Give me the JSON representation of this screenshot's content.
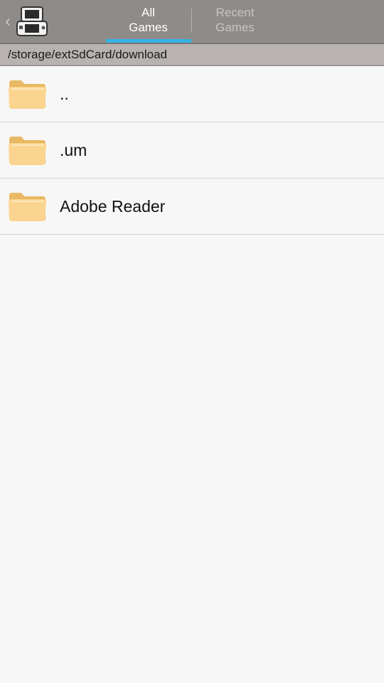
{
  "action_bar": {
    "up_icon": "chevron-left-icon",
    "app_icon": "nintendo-ds-icon",
    "tabs": [
      {
        "label": "All\nGames",
        "selected": true
      },
      {
        "label": "Recent\nGames",
        "selected": false
      }
    ],
    "accent_color": "#33b5e5"
  },
  "path_bar": {
    "path": "/storage/extSdCard/download"
  },
  "files": [
    {
      "name": "..",
      "icon": "folder-icon"
    },
    {
      "name": ".um",
      "icon": "folder-icon"
    },
    {
      "name": "Adobe Reader",
      "icon": "folder-icon"
    }
  ]
}
